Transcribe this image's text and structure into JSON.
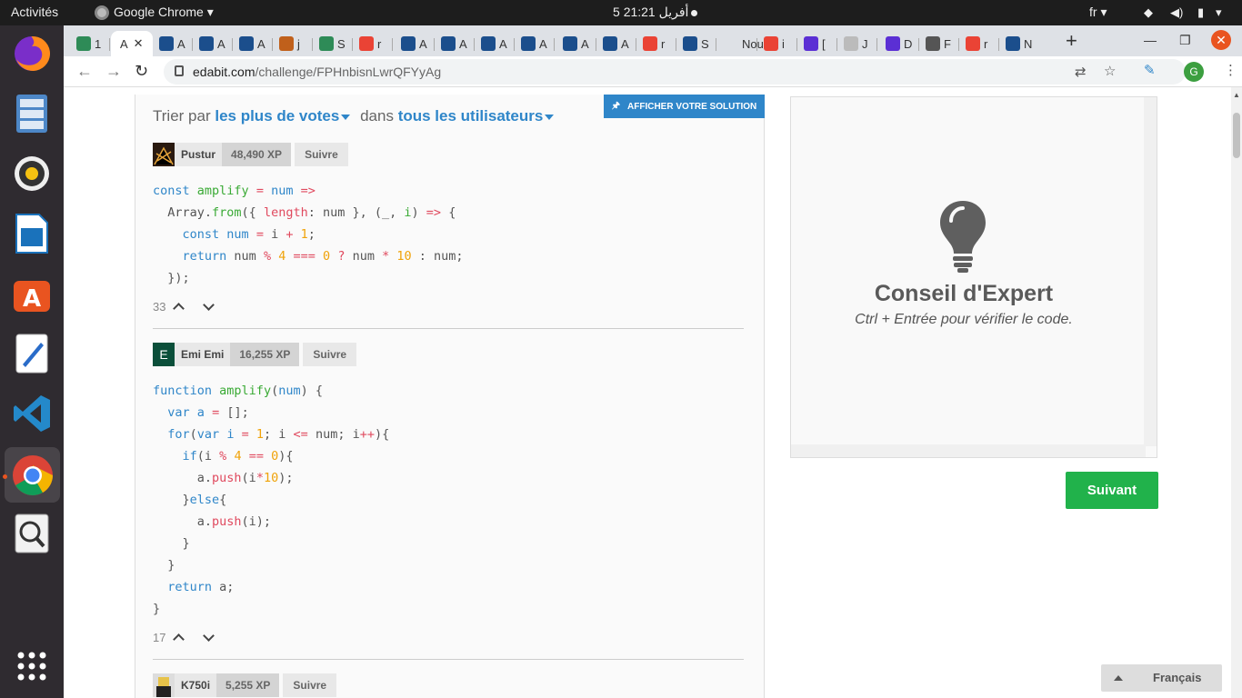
{
  "topbar": {
    "activities": "Activités",
    "app_name": "Google Chrome",
    "clock": "5 أفريل  21:21",
    "lang": "fr"
  },
  "browser": {
    "tabs": [
      {
        "label": "1",
        "color": "#2e8b57"
      },
      {
        "label": "A",
        "color": "#ffffff",
        "active": true
      },
      {
        "label": "A",
        "color": "#1b4e8c"
      },
      {
        "label": "A",
        "color": "#1b4e8c"
      },
      {
        "label": "A",
        "color": "#1b4e8c"
      },
      {
        "label": "j",
        "color": "#c0601b"
      },
      {
        "label": "S",
        "color": "#2e8b57"
      },
      {
        "label": "r",
        "color": "#ea4335"
      },
      {
        "label": "A",
        "color": "#1b4e8c"
      },
      {
        "label": "A",
        "color": "#1b4e8c"
      },
      {
        "label": "A",
        "color": "#1b4e8c"
      },
      {
        "label": "A",
        "color": "#1b4e8c"
      },
      {
        "label": "A",
        "color": "#1b4e8c"
      },
      {
        "label": "A",
        "color": "#1b4e8c"
      },
      {
        "label": "r",
        "color": "#ea4335"
      },
      {
        "label": "S",
        "color": "#1b4e8c"
      },
      {
        "label": "Nou",
        "color": "#dee1e6"
      },
      {
        "label": "i",
        "color": "#ea4335"
      },
      {
        "label": "[",
        "color": "#5b2fd4"
      },
      {
        "label": "J",
        "color": "#bbbbbb"
      },
      {
        "label": "D",
        "color": "#5b2fd4"
      },
      {
        "label": "F",
        "color": "#555555"
      },
      {
        "label": "r",
        "color": "#ea4335"
      },
      {
        "label": "N",
        "color": "#1b4e8c"
      }
    ],
    "url_domain": "edabit.com",
    "url_path": "/challenge/FPHnbisnLwrQFYyAg",
    "avatar_letter": "G"
  },
  "sort": {
    "prefix": "Trier par",
    "by": "les plus de votes",
    "middle": "dans",
    "scope": "tous les utilisateurs"
  },
  "show_solution": "AFFICHER VOTRE SOLUTION",
  "solutions": [
    {
      "user": "Pustur",
      "xp": "48,490 XP",
      "follow": "Suivre",
      "votes": "33"
    },
    {
      "user": "Emi Emi",
      "avatar_letter": "E",
      "xp": "16,255 XP",
      "follow": "Suivre",
      "votes": "17"
    },
    {
      "user": "K750i",
      "xp": "5,255 XP",
      "follow": "Suivre"
    }
  ],
  "tip": {
    "title": "Conseil d'Expert",
    "text": "Ctrl + Entrée pour vérifier le code."
  },
  "next_button": "Suivant",
  "language_button": "Français",
  "colors": {
    "accent": "#2f86c9",
    "success": "#21b24b"
  }
}
